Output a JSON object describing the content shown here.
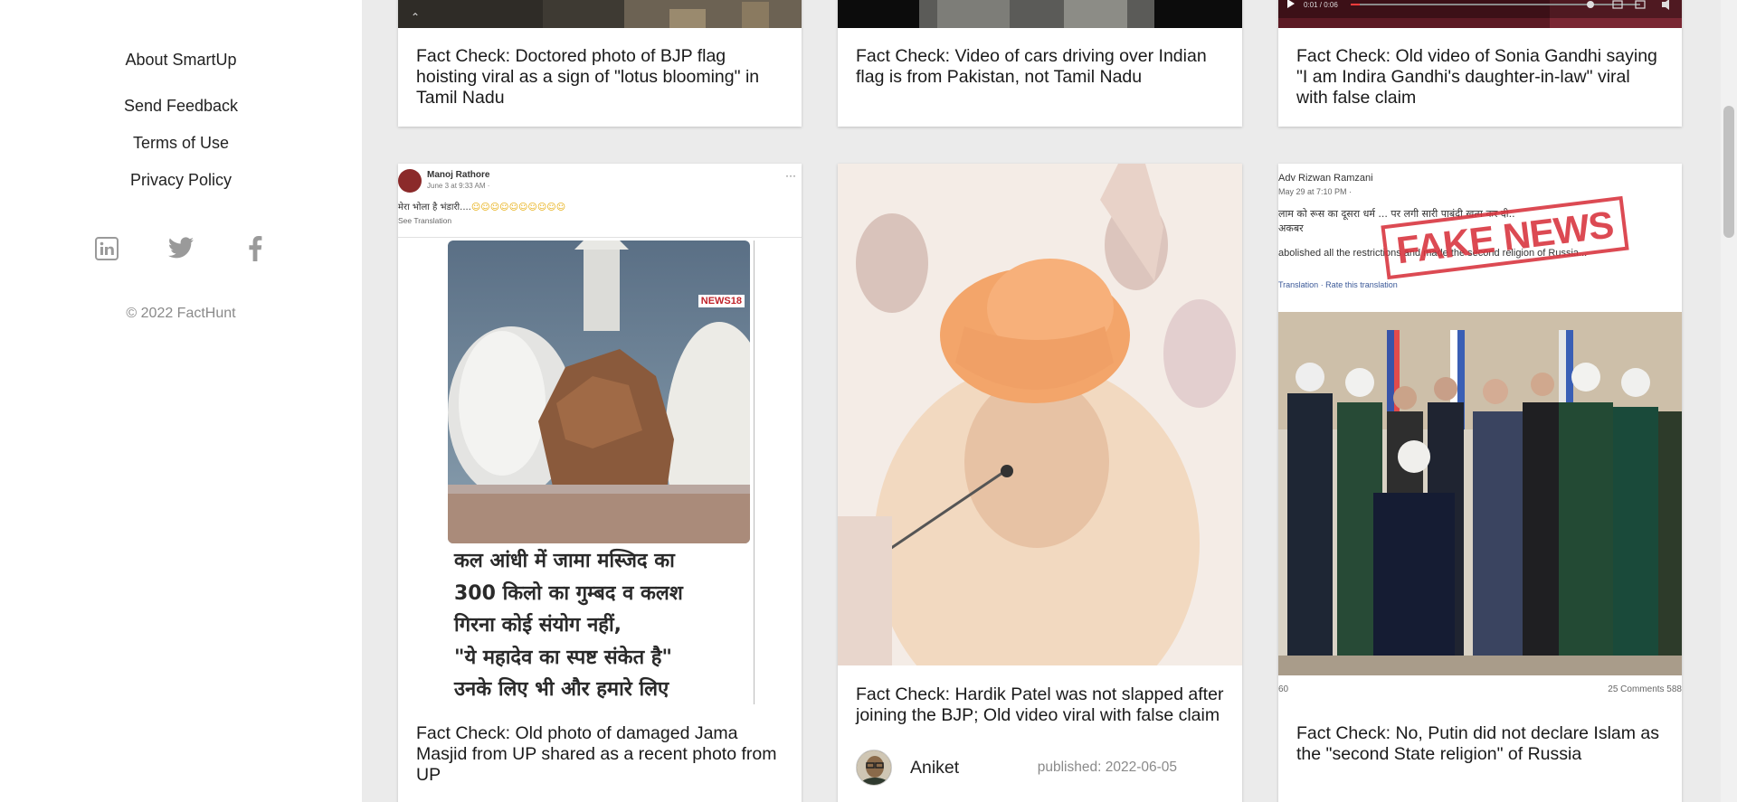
{
  "sidebar": {
    "links": [
      {
        "label": "About SmartUp"
      },
      {
        "label": "Send Feedback"
      },
      {
        "label": "Terms of Use"
      },
      {
        "label": "Privacy Policy"
      }
    ],
    "social_icons": [
      "linkedin-icon",
      "twitter-icon",
      "facebook-icon"
    ],
    "copyright": "© 2022 FactHunt"
  },
  "cards": [
    {
      "title": "Fact Check: Doctored photo of BJP flag hoisting viral as a sign of \"lotus blooming\" in Tamil Nadu"
    },
    {
      "title": "Fact Check: Video of cars driving over Indian flag is from Pakistan, not Tamil Nadu"
    },
    {
      "title": "Fact Check: Old video of Sonia Gandhi saying \"I am Indira Gandhi's daughter-in-law\" viral with false claim"
    },
    {
      "title": "Fact Check: Old photo of damaged Jama Masjid from UP shared as a recent photo from UP",
      "image": {
        "post_author": "Manoj Rathore",
        "post_date": "June 3 at 9:33 AM · ",
        "post_text": "मेरा भोला है भंडारी....",
        "see_translation": "See Translation",
        "channel_badge": "NEWS18",
        "overlay_lines": [
          "कल आंधी में जामा मस्जिद का",
          "300 किलो का गुम्बद व कलश",
          "गिरना कोई संयोग नहीं,",
          "\"ये महादेव का स्पष्ट संकेत है\"",
          "उनके लिए भी और हमारे लिए"
        ]
      }
    },
    {
      "title": "Fact Check: Hardik Patel was not slapped after joining the BJP; Old video viral with false claim",
      "author": "Aniket",
      "published": "published: 2022-06-05"
    },
    {
      "title": "Fact Check: No, Putin did not declare Islam as the \"second State religion\" of Russia",
      "image": {
        "stamp": "FAKE NEWS",
        "post_author": "Adv Rizwan Ramzani",
        "post_date": "May 29 at 7:10 PM · ",
        "post_line1": "लाम को रूस का दूसरा धर्म ... पर लगी सारी पाबंदी खत्म कर दी..",
        "post_line2": "अकबर",
        "post_line3": "abolished all the restrictions and made the second religion of Russia...",
        "post_line4": "Translation · Rate this translation",
        "footer_left": "60",
        "footer_right": "25 Comments  588"
      }
    }
  ]
}
